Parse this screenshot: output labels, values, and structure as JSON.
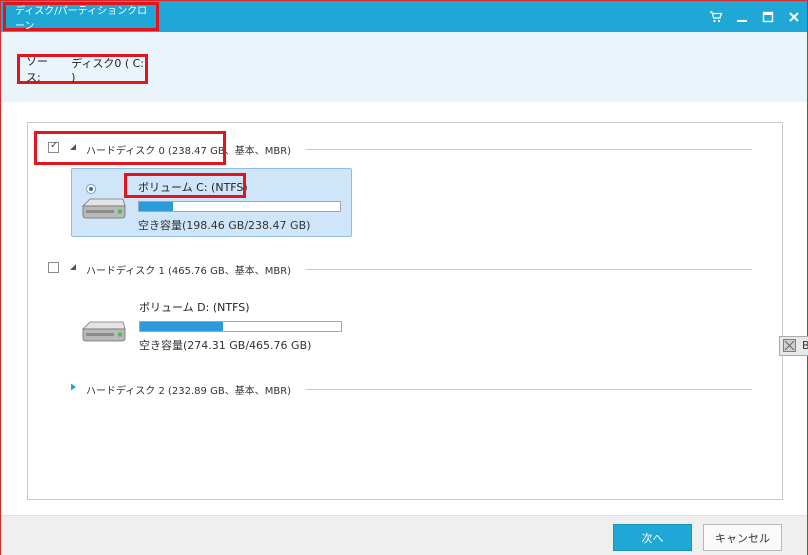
{
  "window": {
    "title": "ディスク/パーティションクローン",
    "controls": [
      "cart-icon",
      "minimize-icon",
      "maximize-icon",
      "close-icon"
    ]
  },
  "source": {
    "label": "ソース:",
    "value": "ディスク0 ( C: )"
  },
  "disks": [
    {
      "label": "ハードディスク 0 (238.47 GB、基本、MBR)",
      "checked": true,
      "expanded": true,
      "volumes": [
        {
          "title": "ボリューム C: (NTFS)",
          "free": "空き容量(198.46 GB/238.47 GB)",
          "used_fraction": 0.168,
          "selected": true
        }
      ]
    },
    {
      "label": "ハードディスク 1 (465.76 GB、基本、MBR)",
      "checked": false,
      "expanded": true,
      "volumes": [
        {
          "title": "ボリューム D: (NTFS)",
          "free": "空き容量(274.31 GB/465.76 GB)",
          "used_fraction": 0.411,
          "selected": false
        }
      ]
    },
    {
      "label": "ハードディスク 2 (232.89 GB、基本、MBR)",
      "checked": false,
      "expanded": false,
      "volumes": []
    }
  ],
  "side_button": {
    "label": "B"
  },
  "footer": {
    "next_label": "次へ",
    "cancel_label": "キャンセル"
  },
  "colors": {
    "titlebar": "#1fa8d6",
    "highlight_border": "#e3141c",
    "selected_volume_bg": "#cfe5f9",
    "usage_bar": "#2b9ad8"
  }
}
